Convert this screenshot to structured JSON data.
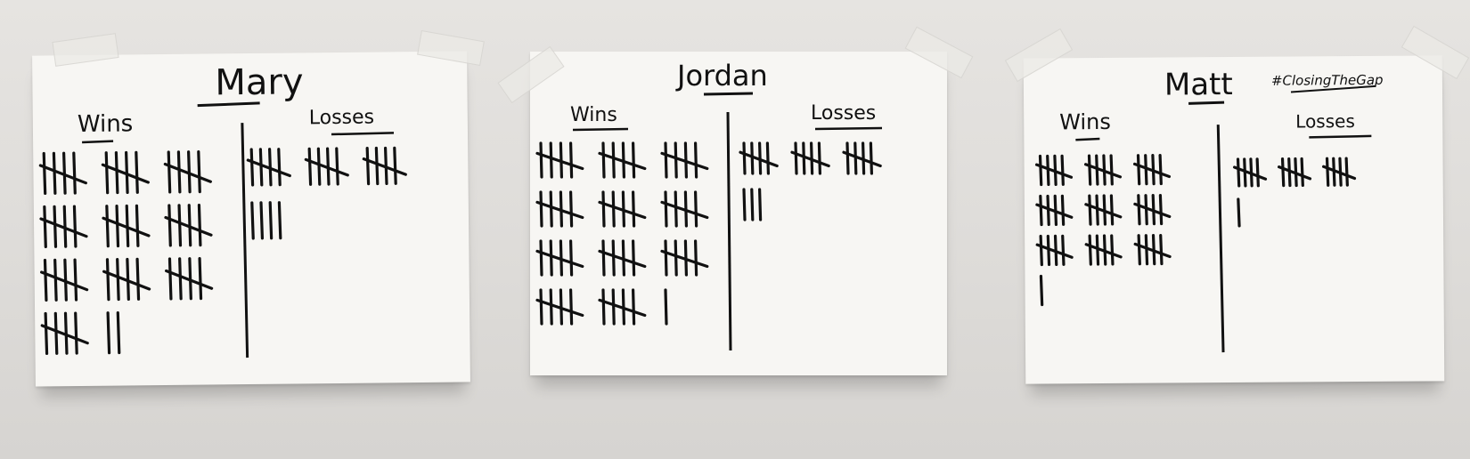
{
  "sheets": [
    {
      "name": "Mary",
      "wins_label": "Wins",
      "losses_label": "Losses",
      "wins": 52,
      "losses": 19
    },
    {
      "name": "Jordan",
      "wins_label": "Wins",
      "losses_label": "Losses",
      "wins": 56,
      "losses": 18
    },
    {
      "name": "Matt",
      "hashtag": "#ClosingTheGap",
      "wins_label": "Wins",
      "losses_label": "Losses",
      "wins": 46,
      "losses": 16
    }
  ]
}
